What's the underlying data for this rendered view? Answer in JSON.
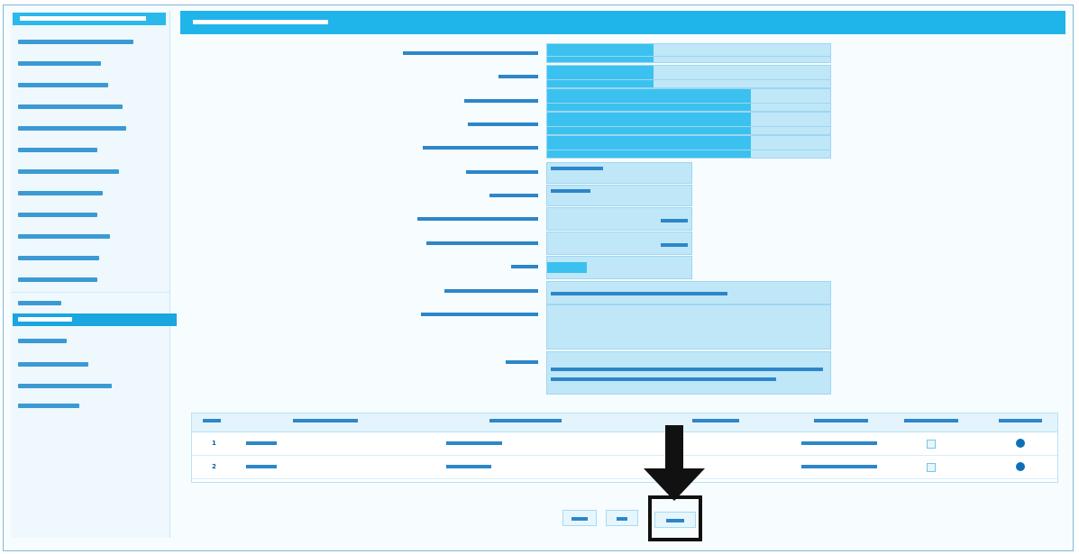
{
  "sidebar": {
    "header": "",
    "items": [
      {
        "label": "",
        "w": 128
      },
      {
        "label": "",
        "w": 92
      },
      {
        "label": "",
        "w": 100
      },
      {
        "label": "",
        "w": 116
      },
      {
        "label": "",
        "w": 120
      },
      {
        "label": "",
        "w": 88
      },
      {
        "label": "",
        "w": 112
      },
      {
        "label": "",
        "w": 94
      },
      {
        "label": "",
        "w": 88
      },
      {
        "label": "",
        "w": 102
      },
      {
        "label": "",
        "w": 90
      },
      {
        "label": "",
        "w": 88
      },
      {
        "label": "",
        "w": 48
      },
      {
        "label": "",
        "w": 60,
        "active": true
      },
      {
        "label": "",
        "w": 54
      },
      {
        "label": "",
        "w": 78
      },
      {
        "label": "",
        "w": 104
      },
      {
        "label": "",
        "w": 68
      }
    ]
  },
  "main": {
    "header": ""
  },
  "form": {
    "labels": [
      "",
      "",
      "",
      "",
      "",
      "",
      "",
      "",
      "",
      "",
      "",
      "",
      ""
    ],
    "values": [
      "",
      "",
      "",
      "",
      "",
      "",
      "",
      "",
      "",
      "",
      "",
      "",
      ""
    ]
  },
  "table": {
    "headers": [
      "",
      "",
      "",
      "",
      "",
      "",
      "",
      ""
    ],
    "rows": [
      [
        "1",
        "",
        "",
        "",
        "",
        "",
        "",
        ""
      ],
      [
        "2",
        "",
        "",
        "",
        "",
        "",
        "",
        ""
      ]
    ]
  },
  "buttons": {
    "b1": "",
    "b2": "",
    "b3": ""
  },
  "colors": {
    "accent": "#1fb4ea",
    "field": "#bfe7f8",
    "field_dark": "#3bc1ef",
    "text": "#0c5f9c"
  },
  "icons": [
    "down-arrow-icon",
    "status-dot-icon",
    "checkbox-icon"
  ]
}
